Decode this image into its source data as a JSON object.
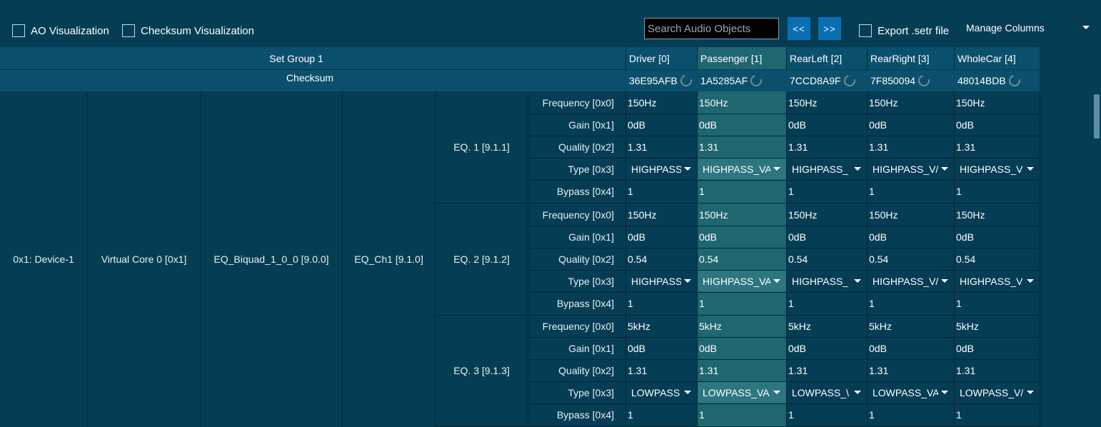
{
  "toolbar": {
    "ao_visualization": "AO Visualization",
    "checksum_visualization": "Checksum Visualization",
    "search_placeholder": "Search Audio Objects",
    "prev_label": "<<",
    "next_label": ">>",
    "export_label": "Export .setr file",
    "manage_columns": "Manage Columns"
  },
  "header": {
    "set_group": "Set Group 1",
    "checksum_label": "Checksum",
    "columns": [
      {
        "name": "Driver [0]",
        "checksum": "36E95AFB"
      },
      {
        "name": "Passenger [1]",
        "checksum": "1A5285AF"
      },
      {
        "name": "RearLeft [2]",
        "checksum": "7CCD8A9F"
      },
      {
        "name": "RearRight [3]",
        "checksum": "7F850094"
      },
      {
        "name": "WholeCar [4]",
        "checksum": "48014BDB"
      }
    ]
  },
  "path": {
    "device": "0x1: Device-1",
    "core": "Virtual Core 0 [0x1]",
    "module": "EQ_Biquad_1_0_0 [9.0.0]",
    "channel": "EQ_Ch1 [9.1.0]"
  },
  "groups": [
    {
      "name": "EQ. 1 [9.1.1]",
      "params": [
        {
          "label": "Frequency [0x0]",
          "values": [
            "150Hz",
            "150Hz",
            "150Hz",
            "150Hz",
            "150Hz"
          ]
        },
        {
          "label": "Gain [0x1]",
          "values": [
            "0dB",
            "0dB",
            "0dB",
            "0dB",
            "0dB"
          ]
        },
        {
          "label": "Quality [0x2]",
          "values": [
            "1.31",
            "1.31",
            "1.31",
            "1.31",
            "1.31"
          ]
        },
        {
          "label": "Type [0x3]",
          "dropdown": true,
          "values": [
            "HIGHPASS",
            "HIGHPASS_VA",
            "HIGHPASS_",
            "HIGHPASS_V/",
            "HIGHPASS_V"
          ]
        },
        {
          "label": "Bypass [0x4]",
          "values": [
            "1",
            "1",
            "1",
            "1",
            "1"
          ]
        }
      ]
    },
    {
      "name": "EQ. 2 [9.1.2]",
      "params": [
        {
          "label": "Frequency [0x0]",
          "values": [
            "150Hz",
            "150Hz",
            "150Hz",
            "150Hz",
            "150Hz"
          ]
        },
        {
          "label": "Gain [0x1]",
          "values": [
            "0dB",
            "0dB",
            "0dB",
            "0dB",
            "0dB"
          ]
        },
        {
          "label": "Quality [0x2]",
          "values": [
            "0.54",
            "0.54",
            "0.54",
            "0.54",
            "0.54"
          ]
        },
        {
          "label": "Type [0x3]",
          "dropdown": true,
          "values": [
            "HIGHPASS",
            "HIGHPASS_VA",
            "HIGHPASS_",
            "HIGHPASS_V/",
            "HIGHPASS_V"
          ]
        },
        {
          "label": "Bypass [0x4]",
          "values": [
            "1",
            "1",
            "1",
            "1",
            "1"
          ]
        }
      ]
    },
    {
      "name": "EQ. 3 [9.1.3]",
      "params": [
        {
          "label": "Frequency [0x0]",
          "values": [
            "5kHz",
            "5kHz",
            "5kHz",
            "5kHz",
            "5kHz"
          ]
        },
        {
          "label": "Gain [0x1]",
          "values": [
            "0dB",
            "0dB",
            "0dB",
            "0dB",
            "0dB"
          ]
        },
        {
          "label": "Quality [0x2]",
          "values": [
            "1.31",
            "1.31",
            "1.31",
            "1.31",
            "1.31"
          ]
        },
        {
          "label": "Type [0x3]",
          "dropdown": true,
          "values": [
            "LOWPASS",
            "LOWPASS_VA",
            "LOWPASS_\\",
            "LOWPASS_VA",
            "LOWPASS_V/"
          ]
        },
        {
          "label": "Bypass [0x4]",
          "values": [
            "1",
            "1",
            "1",
            "1",
            "1"
          ]
        }
      ]
    }
  ],
  "colors": {
    "background": "#053d55",
    "header": "#0a506c",
    "highlight_column": "#1e6670",
    "nav_button": "#0a6fb2"
  },
  "icons": {
    "dropdown": "chevron-down-icon",
    "refresh": "refresh-icon",
    "checkbox": "checkbox-icon"
  }
}
